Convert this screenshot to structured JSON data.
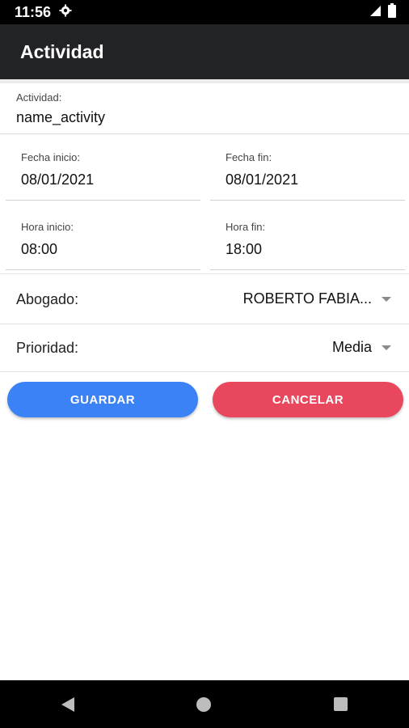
{
  "status_bar": {
    "time": "11:56",
    "icons": [
      "gear-icon",
      "signal-icon",
      "battery-icon"
    ]
  },
  "app_bar": {
    "title": "Actividad"
  },
  "form": {
    "actividad": {
      "label": "Actividad:",
      "value": "name_activity"
    },
    "fecha_inicio": {
      "label": "Fecha inicio:",
      "value": "08/01/2021"
    },
    "fecha_fin": {
      "label": "Fecha fin:",
      "value": "08/01/2021"
    },
    "hora_inicio": {
      "label": "Hora inicio:",
      "value": "08:00"
    },
    "hora_fin": {
      "label": "Hora fin:",
      "value": "18:00"
    },
    "abogado": {
      "label": "Abogado:",
      "value": "ROBERTO FABIA..."
    },
    "prioridad": {
      "label": "Prioridad:",
      "value": "Media"
    }
  },
  "buttons": {
    "save_label": "GUARDAR",
    "cancel_label": "CANCELAR"
  },
  "colors": {
    "app_bar": "#222326",
    "save": "#3b82f6",
    "cancel": "#e8475d"
  },
  "nav_bar": {
    "icons": [
      "back-icon",
      "home-icon",
      "recents-icon"
    ]
  }
}
